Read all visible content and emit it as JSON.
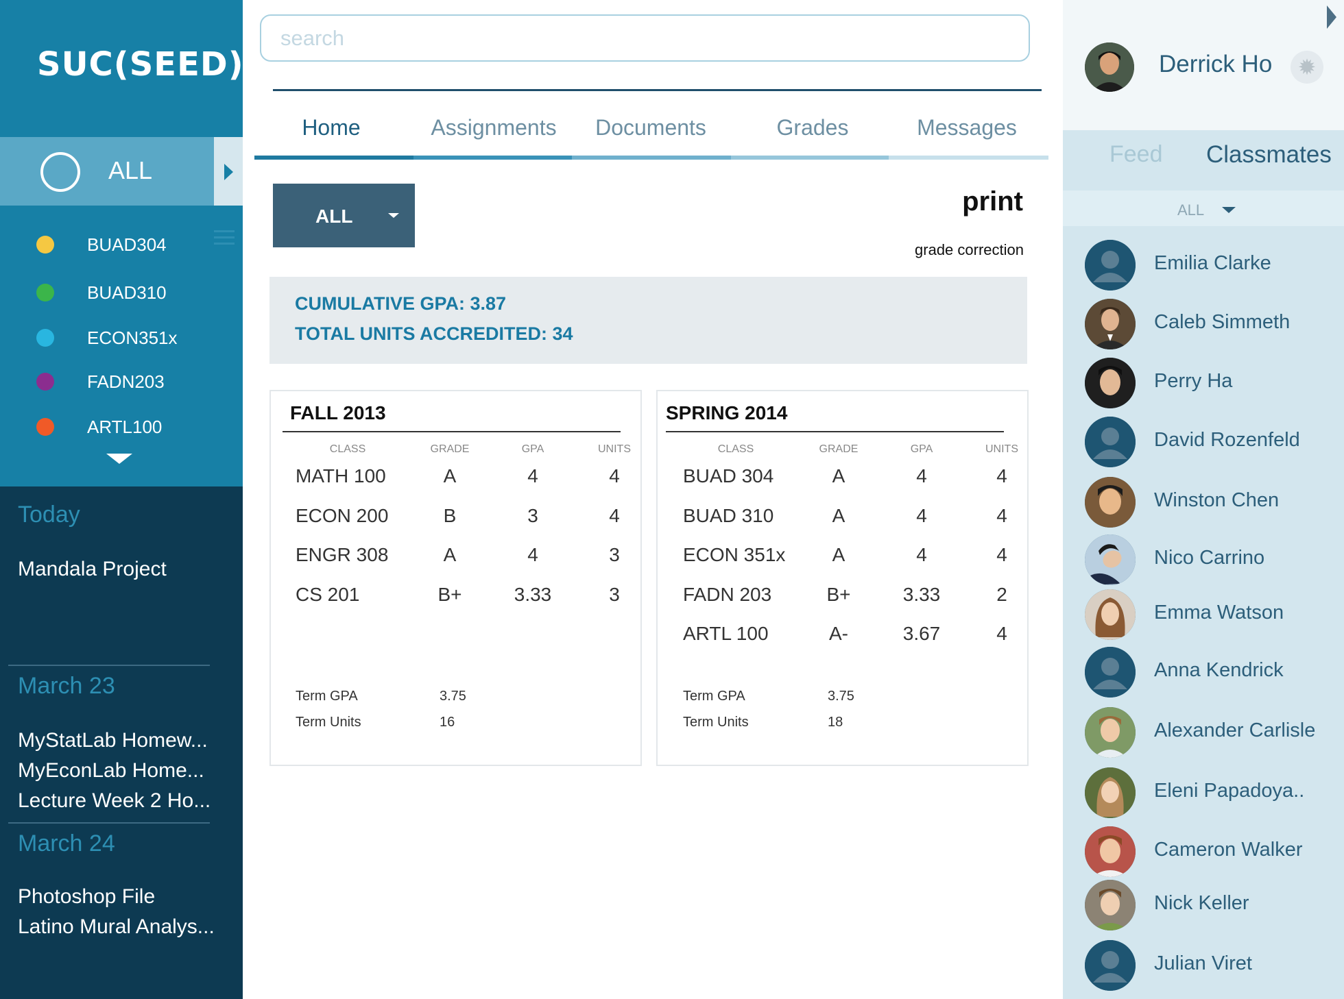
{
  "app": {
    "logo": "SUC(SEED)"
  },
  "sidebar": {
    "all_label": "ALL",
    "courses": [
      {
        "name": "BUAD304",
        "color": "#f5c842"
      },
      {
        "name": "BUAD310",
        "color": "#3bb54a"
      },
      {
        "name": "ECON351x",
        "color": "#29b6e0"
      },
      {
        "name": "FADN203",
        "color": "#8b2d8f"
      },
      {
        "name": "ARTL100",
        "color": "#f05a28"
      }
    ],
    "sections": [
      {
        "heading": "Today",
        "items": [
          "Mandala Project"
        ]
      },
      {
        "heading": "March 23",
        "items": [
          "MyStatLab Homew...",
          "MyEconLab Home...",
          "Lecture Week 2 Ho..."
        ]
      },
      {
        "heading": "March 24",
        "items": [
          "Photoshop File",
          "Latino Mural Analys..."
        ]
      }
    ]
  },
  "search": {
    "placeholder": "search"
  },
  "tabs": [
    {
      "label": "Home",
      "active": true
    },
    {
      "label": "Assignments",
      "active": false
    },
    {
      "label": "Documents",
      "active": false
    },
    {
      "label": "Grades",
      "active": false
    },
    {
      "label": "Messages",
      "active": false
    }
  ],
  "grades": {
    "filter_value": "ALL",
    "print_label": "print",
    "grade_correction_label": "grade correction",
    "cumulative_gpa": "CUMULATIVE GPA: 3.87",
    "total_units": "TOTAL UNITS ACCREDITED: 34",
    "columns": [
      "CLASS",
      "GRADE",
      "GPA",
      "UNITS"
    ],
    "terms": [
      {
        "title": "FALL 2013",
        "rows": [
          [
            "MATH 100",
            "A",
            "4",
            "4"
          ],
          [
            "ECON 200",
            "B",
            "3",
            "4"
          ],
          [
            "ENGR 308",
            "A",
            "4",
            "3"
          ],
          [
            "CS 201",
            "B+",
            "3.33",
            "3"
          ]
        ],
        "term_gpa_label": "Term GPA",
        "term_gpa": "3.75",
        "term_units_label": "Term Units",
        "term_units": "16"
      },
      {
        "title": "SPRING 2014",
        "rows": [
          [
            "BUAD 304",
            "A",
            "4",
            "4"
          ],
          [
            "BUAD 310",
            "A",
            "4",
            "4"
          ],
          [
            "ECON 351x",
            "A",
            "4",
            "4"
          ],
          [
            "FADN 203",
            "B+",
            "3.33",
            "2"
          ],
          [
            "ARTL 100",
            "A-",
            "3.67",
            "4"
          ]
        ],
        "term_gpa_label": "Term GPA",
        "term_gpa": "3.75",
        "term_units_label": "Term Units",
        "term_units": "18"
      }
    ]
  },
  "right_panel": {
    "user_name": "Derrick Ho",
    "tab_feed": "Feed",
    "tab_classmates": "Classmates",
    "filter_value": "ALL",
    "classmates": [
      "Emilia Clarke",
      "Caleb Simmeth",
      "Perry Ha",
      "David Rozenfeld",
      "Winston Chen",
      "Nico Carrino",
      "Emma Watson",
      "Anna Kendrick",
      "Alexander Carlisle",
      "Eleni Papadoya..",
      "Cameron Walker",
      "Nick Keller",
      "Julian Viret"
    ]
  }
}
